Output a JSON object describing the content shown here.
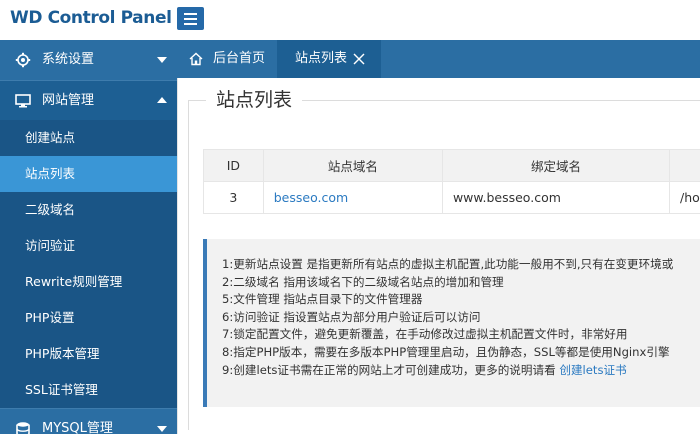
{
  "header": {
    "logo": "WD Control Panel"
  },
  "sidebar": {
    "groups": [
      {
        "label": "系统设置",
        "icon": "gear-icon"
      },
      {
        "label": "网站管理",
        "icon": "monitor-icon"
      },
      {
        "label": "MYSQL管理",
        "icon": "database-icon"
      }
    ],
    "items": [
      {
        "label": "创建站点"
      },
      {
        "label": "站点列表"
      },
      {
        "label": "二级域名"
      },
      {
        "label": "访问验证"
      },
      {
        "label": "Rewrite规则管理"
      },
      {
        "label": "PHP设置"
      },
      {
        "label": "PHP版本管理"
      },
      {
        "label": "SSL证书管理"
      }
    ]
  },
  "tabs": {
    "home": "后台首页",
    "current": "站点列表"
  },
  "main": {
    "title": "站点列表",
    "table": {
      "headers": [
        "ID",
        "站点域名",
        "绑定域名",
        ""
      ],
      "rows": [
        {
          "id": "3",
          "site": "besseo.com",
          "bind": "www.besseo.com",
          "path": "/hom"
        }
      ]
    },
    "tips": [
      "1:更新站点设置 是指更新所有站点的虚拟主机配置,此功能一般用不到,只有在变更环境或",
      "2:二级域名 指用该域名下的二级域名站点的增加和管理",
      "5:文件管理 指站点目录下的文件管理器",
      "6:访问验证 指设置站点为部分用户验证后可以访问",
      "7:锁定配置文件，避免更新覆盖，在手动修改过虚拟主机配置文件时，非常好用",
      "8:指定PHP版本，需要在多版本PHP管理里启动，且伪静态，SSL等都是使用Nginx引擎",
      "9:创建lets证书需在正常的网站上才可创建成功，更多的说明请看 "
    ],
    "tip_link": "创建lets证书"
  },
  "colors": {
    "sidebar": "#1d5f93",
    "tab_bar": "#2b6ea3",
    "active_item": "#3a96d6",
    "logo": "#1b5c94",
    "link": "#2b7ac1"
  }
}
